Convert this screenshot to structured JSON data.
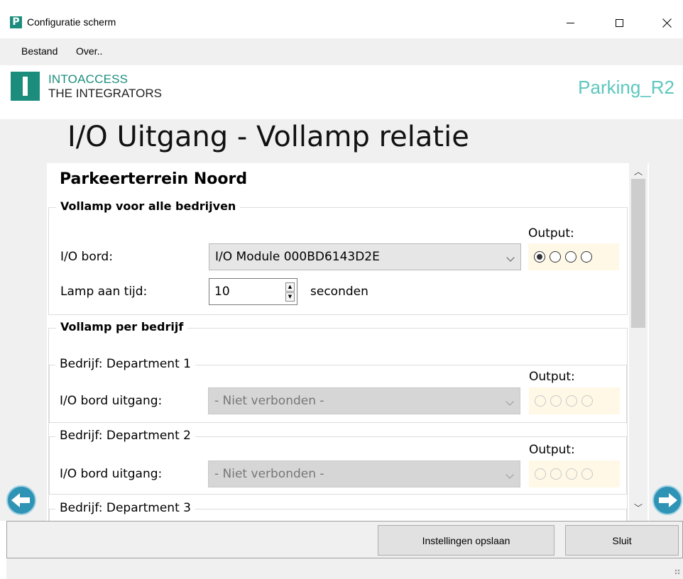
{
  "window": {
    "app_icon_letter": "P",
    "title": "Configuratie scherm"
  },
  "menu": {
    "items": [
      "Bestand",
      "Over.."
    ]
  },
  "brand": {
    "line1": "INTOACCESS",
    "line2": "THE INTEGRATORS",
    "device_name": "Parking_R2"
  },
  "page": {
    "title": "I/O Uitgang - Vollamp relatie"
  },
  "panel": {
    "area_title": "Parkeerterrein Noord",
    "all_companies": {
      "legend": "Vollamp voor alle bedrijven",
      "output_label": "Output:",
      "board_label": "I/O bord:",
      "board_value": "I/O Module 000BD6143D2E",
      "lamp_time_label": "Lamp aan tijd:",
      "lamp_time_value": "10",
      "lamp_time_unit": "seconden",
      "output_selected_index": 0
    },
    "per_company": {
      "legend": "Vollamp per bedrijf",
      "companies": [
        {
          "legend": "Bedrijf: Department 1",
          "output_label": "Output:",
          "board_label": "I/O bord uitgang:",
          "board_value": "- Niet verbonden -"
        },
        {
          "legend": "Bedrijf: Department 2",
          "output_label": "Output:",
          "board_label": "I/O bord uitgang:",
          "board_value": "- Niet verbonden -"
        },
        {
          "legend": "Bedrijf: Department 3"
        }
      ]
    }
  },
  "footer": {
    "save_label": "Instellingen opslaan",
    "close_label": "Sluit"
  },
  "colors": {
    "brand_teal": "#1c8d7d",
    "device_name": "#5cc7bd",
    "nav_arrow": "#2f93b5",
    "output_background": "#fff8e6"
  },
  "icons": [
    "app-icon",
    "logo",
    "minimize-icon",
    "maximize-icon",
    "close-icon",
    "chevron-down-icon",
    "spin-up-icon",
    "spin-down-icon",
    "arrow-left-icon",
    "arrow-right-icon",
    "scroll-up-icon",
    "scroll-down-icon"
  ]
}
